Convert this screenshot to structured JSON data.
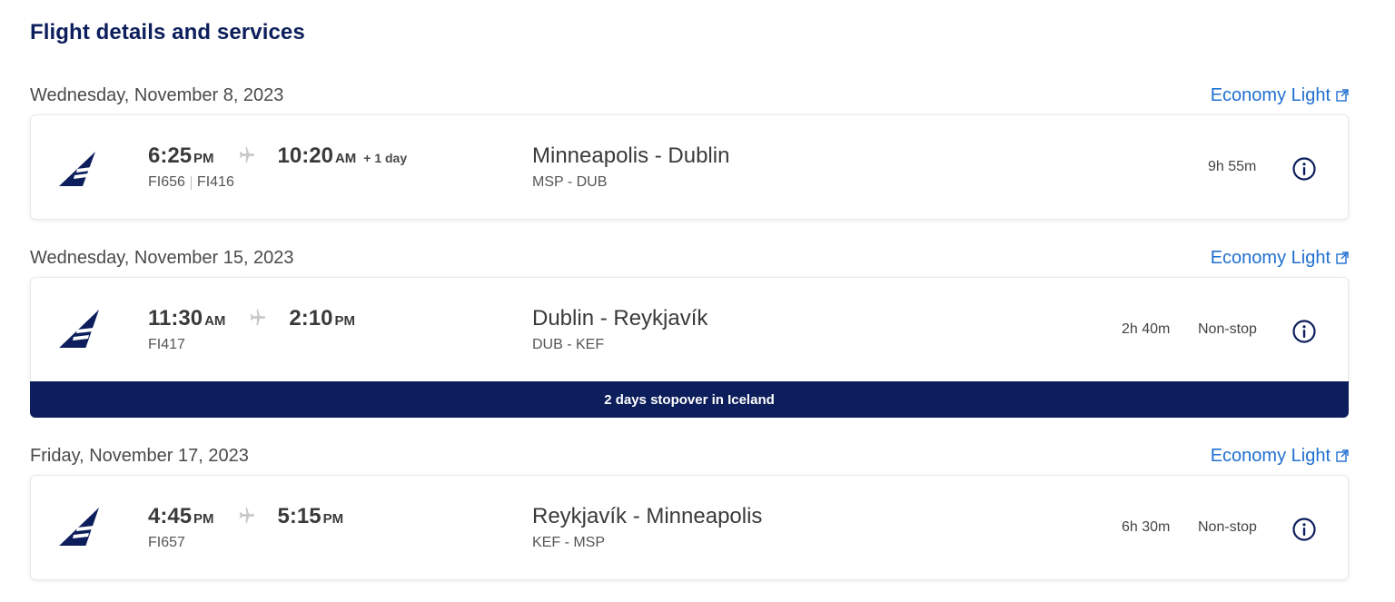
{
  "title": "Flight details and services",
  "segments": [
    {
      "date": "Wednesday, November 8, 2023",
      "fare": "Economy Light",
      "dep_time": "6:25",
      "dep_ampm": "PM",
      "arr_time": "10:20",
      "arr_ampm": "AM",
      "plus_day": "+ 1 day",
      "flight_numbers": [
        "FI656",
        "FI416"
      ],
      "route": "Minneapolis - Dublin",
      "codes": "MSP - DUB",
      "duration": "9h 55m",
      "stops": ""
    },
    {
      "date": "Wednesday, November 15, 2023",
      "fare": "Economy Light",
      "dep_time": "11:30",
      "dep_ampm": "AM",
      "arr_time": "2:10",
      "arr_ampm": "PM",
      "plus_day": "",
      "flight_numbers": [
        "FI417"
      ],
      "route": "Dublin - Reykjavík",
      "codes": "DUB - KEF",
      "duration": "2h 40m",
      "stops": "Non-stop"
    },
    {
      "date": "Friday, November 17, 2023",
      "fare": "Economy Light",
      "dep_time": "4:45",
      "dep_ampm": "PM",
      "arr_time": "5:15",
      "arr_ampm": "PM",
      "plus_day": "",
      "flight_numbers": [
        "FI657"
      ],
      "route": "Reykjavík - Minneapolis",
      "codes": "KEF - MSP",
      "duration": "6h 30m",
      "stops": "Non-stop"
    }
  ],
  "stopover_banner": "2 days stopover in Iceland",
  "colors": {
    "brand_navy": "#0c1e5b",
    "link_blue": "#1f6fd1"
  },
  "icons": {
    "airline_logo": "icelandair-tail-logo-icon",
    "plane": "plane-icon",
    "external_link": "external-link-icon",
    "info": "info-icon"
  }
}
